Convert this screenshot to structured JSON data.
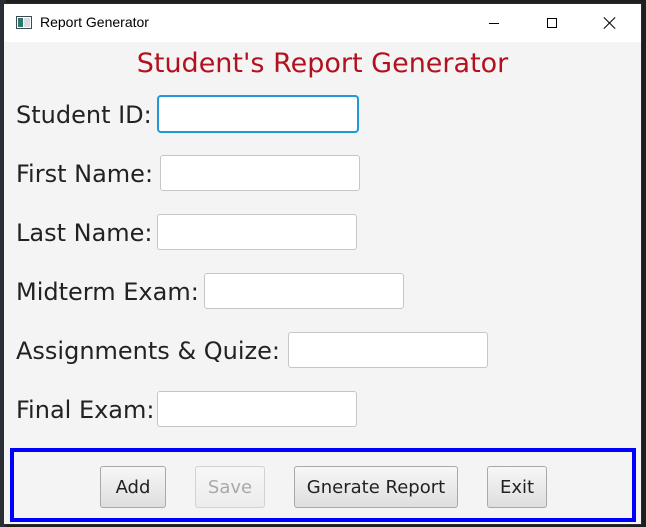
{
  "window": {
    "title": "Report Generator"
  },
  "form": {
    "heading": "Student's Report Generator",
    "fields": [
      {
        "label": "Student ID:",
        "value": "",
        "placeholder": ""
      },
      {
        "label": "First Name:",
        "value": "",
        "placeholder": ""
      },
      {
        "label": "Last Name:",
        "value": "",
        "placeholder": ""
      },
      {
        "label": "Midterm Exam:",
        "value": "",
        "placeholder": ""
      },
      {
        "label": "Assignments & Quize:",
        "value": "",
        "placeholder": ""
      },
      {
        "label": "Final Exam:",
        "value": "",
        "placeholder": ""
      }
    ]
  },
  "buttons": {
    "add": "Add",
    "save": "Save",
    "generate": "Gnerate Report",
    "exit": "Exit"
  },
  "colors": {
    "heading": "#b2121f",
    "panel_border": "#0000ff",
    "focus": "#1e9bd7"
  }
}
